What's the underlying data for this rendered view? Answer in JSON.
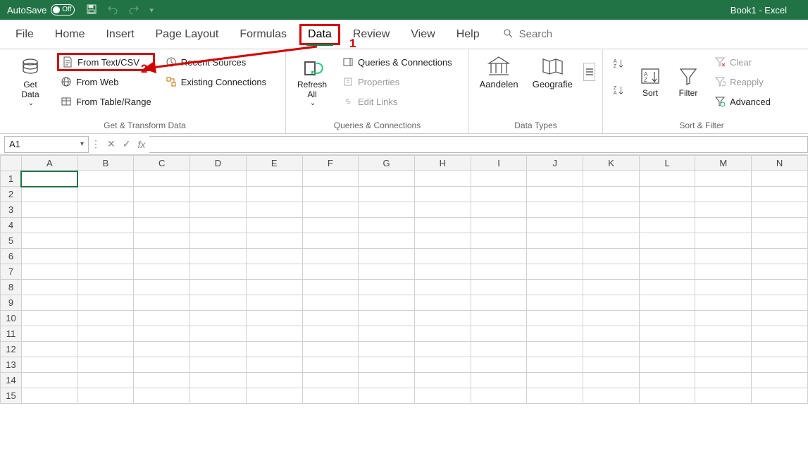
{
  "titlebar": {
    "autosave_label": "AutoSave",
    "autosave_state": "Off",
    "doc_title": "Book1  -  Excel"
  },
  "tabs": {
    "file": "File",
    "home": "Home",
    "insert": "Insert",
    "page_layout": "Page Layout",
    "formulas": "Formulas",
    "data": "Data",
    "review": "Review",
    "view": "View",
    "help": "Help",
    "search_placeholder": "Search"
  },
  "ribbon": {
    "get_transform": {
      "label": "Get & Transform Data",
      "get_data": "Get\nData",
      "from_text_csv": "From Text/CSV",
      "from_web": "From Web",
      "from_table": "From Table/Range",
      "recent_sources": "Recent Sources",
      "existing_connections": "Existing Connections"
    },
    "queries": {
      "label": "Queries & Connections",
      "refresh_all": "Refresh\nAll",
      "queries_connections": "Queries & Connections",
      "properties": "Properties",
      "edit_links": "Edit Links"
    },
    "data_types": {
      "label": "Data Types",
      "aandelen": "Aandelen",
      "geografie": "Geografie"
    },
    "sort_filter": {
      "label": "Sort & Filter",
      "sort": "Sort",
      "filter": "Filter",
      "clear": "Clear",
      "reapply": "Reapply",
      "advanced": "Advanced"
    }
  },
  "formula_bar": {
    "name_box": "A1",
    "fx": "fx"
  },
  "grid": {
    "columns": [
      "A",
      "B",
      "C",
      "D",
      "E",
      "F",
      "G",
      "H",
      "I",
      "J",
      "K",
      "L",
      "M",
      "N"
    ],
    "rows": [
      "1",
      "2",
      "3",
      "4",
      "5",
      "6",
      "7",
      "8",
      "9",
      "10",
      "11",
      "12",
      "13",
      "14",
      "15"
    ],
    "selected_cell": "A1"
  },
  "annotations": {
    "step1": "1",
    "step2": "2"
  }
}
